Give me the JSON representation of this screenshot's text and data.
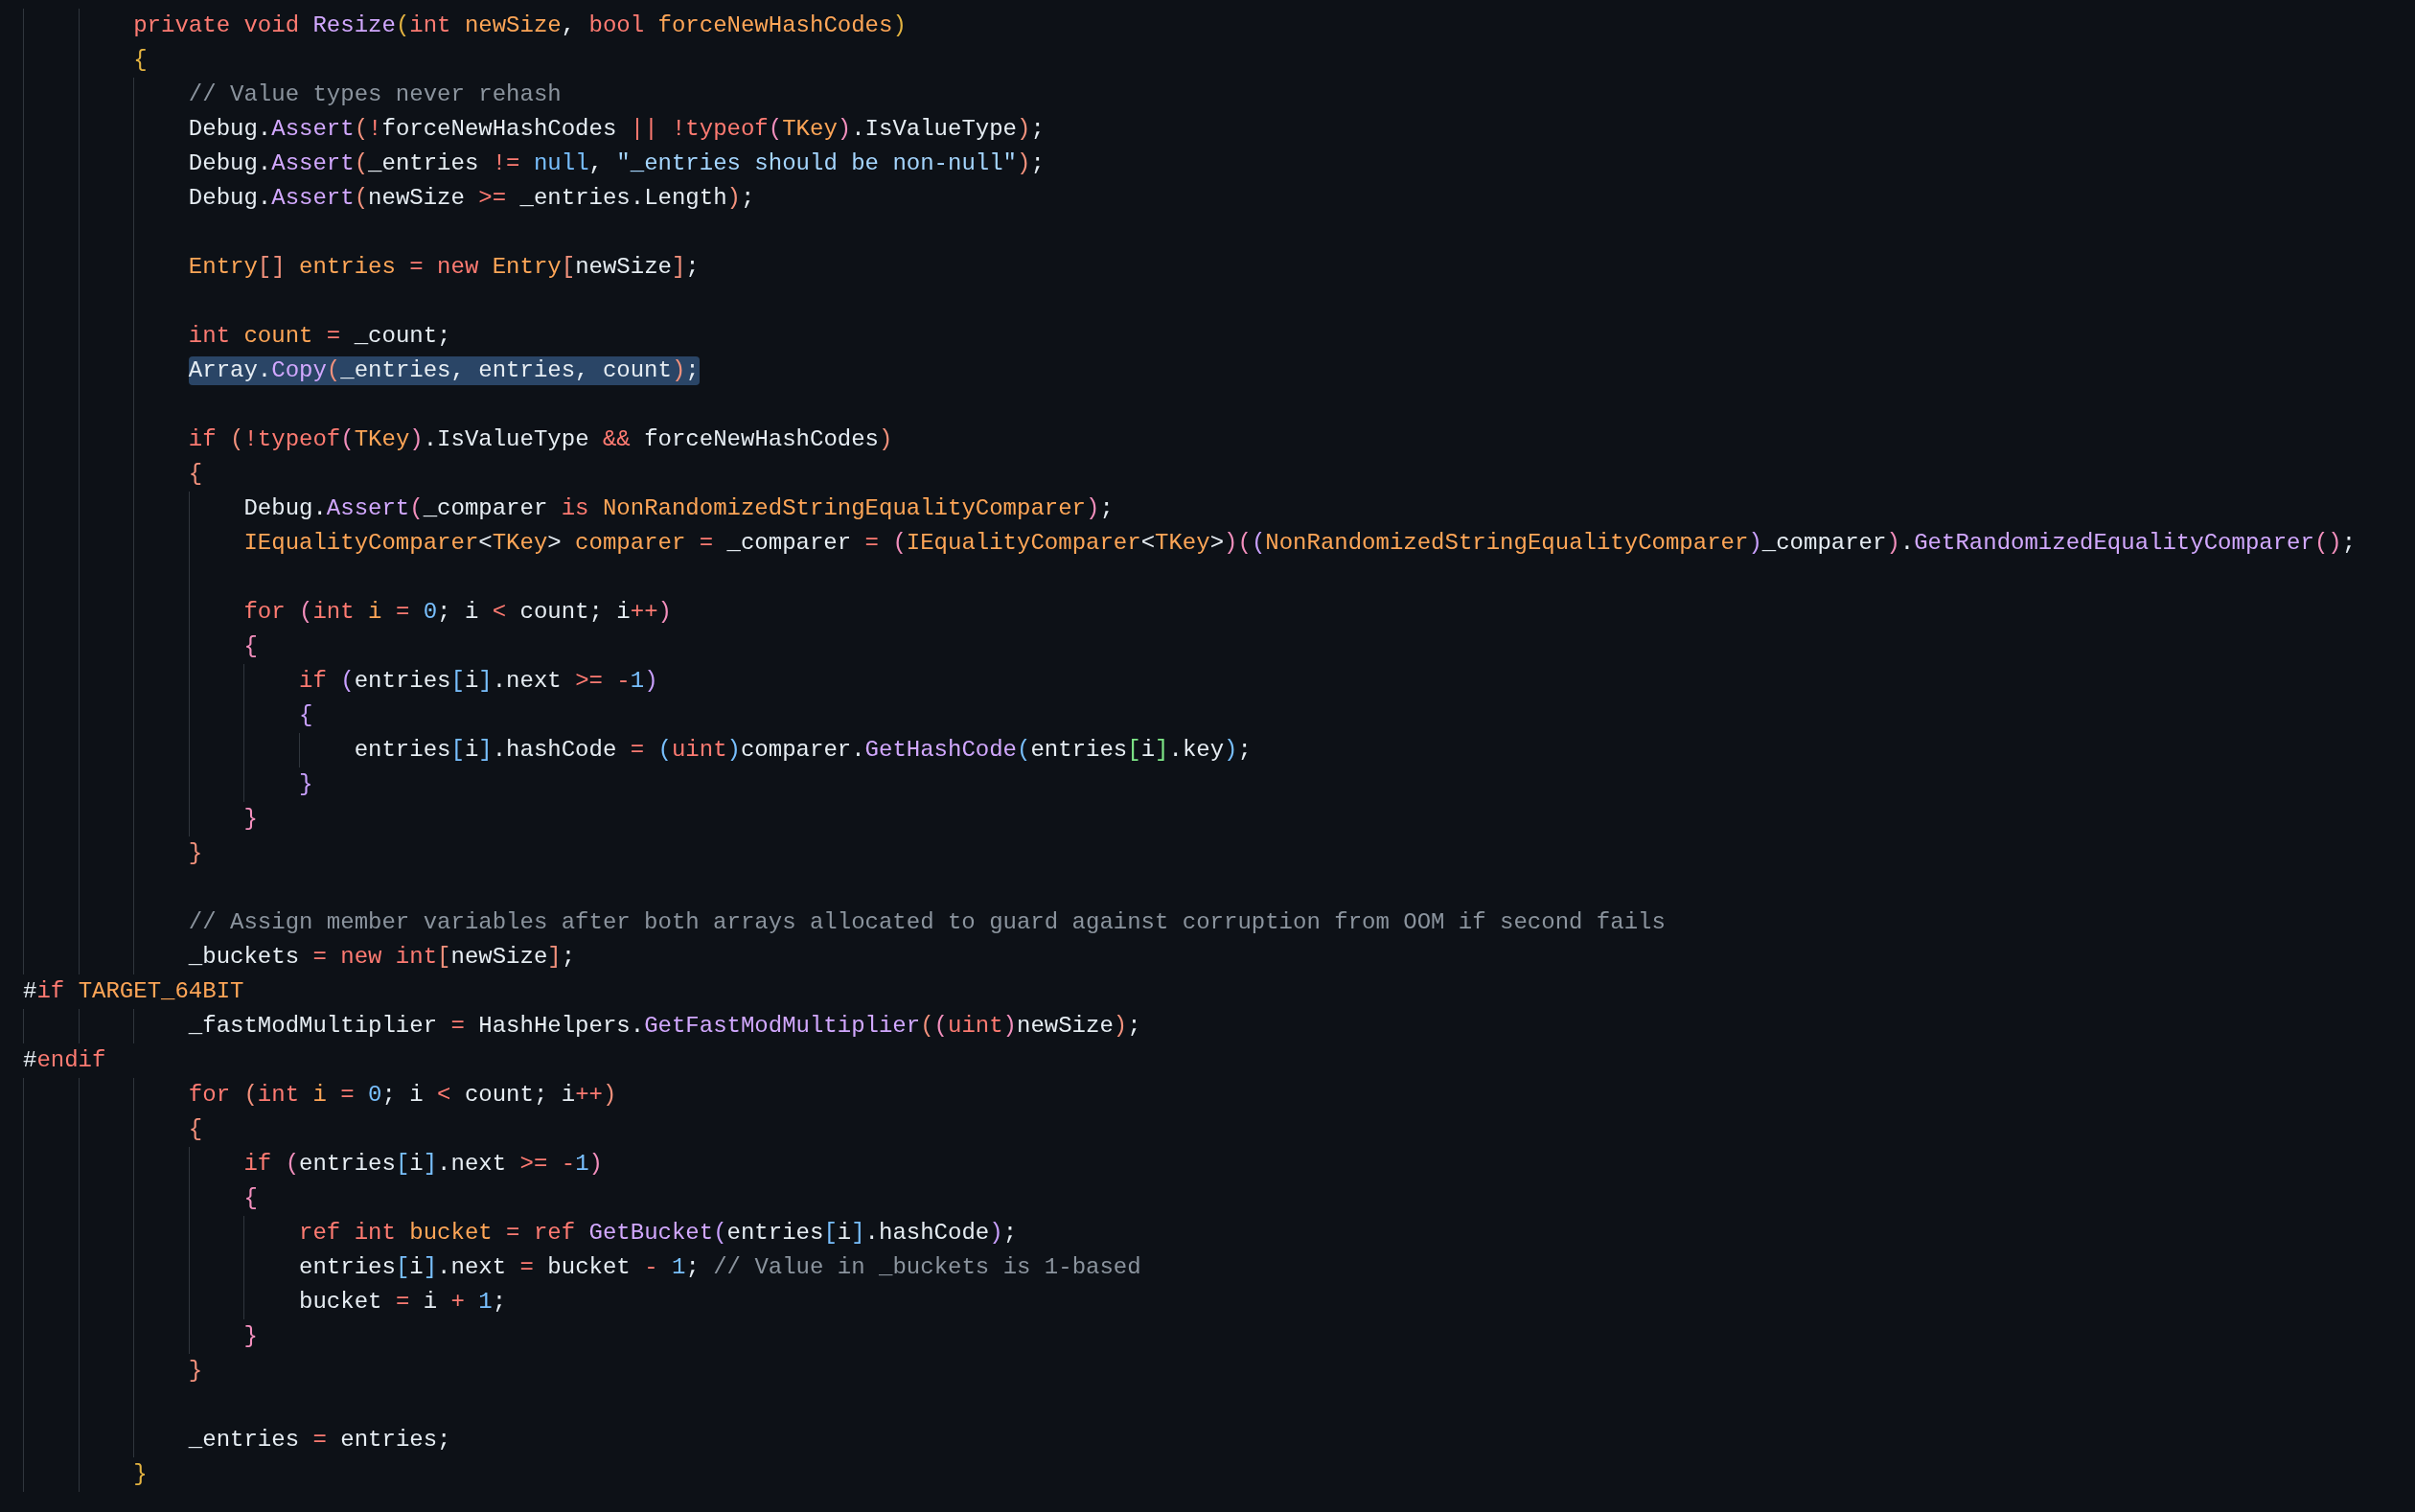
{
  "editor": {
    "lines": [
      {
        "kind": "code",
        "selected": false,
        "tokens": [
          {
            "kind": "keyword",
            "text": "private void "
          },
          {
            "kind": "method",
            "text": "Resize"
          },
          {
            "kind": "brace1",
            "text": "("
          },
          {
            "kind": "keyword",
            "text": "int "
          },
          {
            "kind": "type",
            "text": "newSize"
          },
          {
            "kind": "plain",
            "text": ", "
          },
          {
            "kind": "keyword",
            "text": "bool "
          },
          {
            "kind": "type",
            "text": "forceNewHashCodes"
          },
          {
            "kind": "brace1",
            "text": ")"
          }
        ]
      },
      {
        "kind": "code",
        "selected": false,
        "tokens": [
          {
            "kind": "brace1",
            "text": "{"
          }
        ],
        "children": [
          {
            "kind": "code",
            "selected": false,
            "tokens": [
              {
                "kind": "comment",
                "text": "// Value types never rehash"
              }
            ]
          },
          {
            "kind": "code",
            "selected": false,
            "tokens": [
              {
                "kind": "plain",
                "text": "Debug."
              },
              {
                "kind": "method",
                "text": "Assert"
              },
              {
                "kind": "brace2",
                "text": "("
              },
              {
                "kind": "keyword",
                "text": "!"
              },
              {
                "kind": "plain",
                "text": "forceNewHashCodes "
              },
              {
                "kind": "keyword",
                "text": "|| !typeof"
              },
              {
                "kind": "brace3",
                "text": "("
              },
              {
                "kind": "type",
                "text": "TKey"
              },
              {
                "kind": "brace3",
                "text": ")"
              },
              {
                "kind": "plain",
                "text": ".IsValueType"
              },
              {
                "kind": "brace2",
                "text": ")"
              },
              {
                "kind": "plain",
                "text": ";"
              }
            ]
          },
          {
            "kind": "code",
            "selected": false,
            "tokens": [
              {
                "kind": "plain",
                "text": "Debug."
              },
              {
                "kind": "method",
                "text": "Assert"
              },
              {
                "kind": "brace2",
                "text": "("
              },
              {
                "kind": "plain",
                "text": "_entries "
              },
              {
                "kind": "keyword",
                "text": "!= "
              },
              {
                "kind": "number",
                "text": "null"
              },
              {
                "kind": "plain",
                "text": ", "
              },
              {
                "kind": "string",
                "text": "\"_entries should be non-null\""
              },
              {
                "kind": "brace2",
                "text": ")"
              },
              {
                "kind": "plain",
                "text": ";"
              }
            ]
          },
          {
            "kind": "code",
            "selected": false,
            "tokens": [
              {
                "kind": "plain",
                "text": "Debug."
              },
              {
                "kind": "method",
                "text": "Assert"
              },
              {
                "kind": "brace2",
                "text": "("
              },
              {
                "kind": "plain",
                "text": "newSize "
              },
              {
                "kind": "keyword",
                "text": ">= "
              },
              {
                "kind": "plain",
                "text": "_entries.Length"
              },
              {
                "kind": "brace2",
                "text": ")"
              },
              {
                "kind": "plain",
                "text": ";"
              }
            ]
          },
          {
            "kind": "code",
            "selected": false
          },
          {
            "kind": "code",
            "selected": false,
            "tokens": [
              {
                "kind": "type",
                "text": "Entry"
              },
              {
                "kind": "brace2",
                "text": "[]"
              },
              {
                "kind": "type",
                "text": " entries "
              },
              {
                "kind": "keyword",
                "text": "= new "
              },
              {
                "kind": "type",
                "text": "Entry"
              },
              {
                "kind": "brace2",
                "text": "["
              },
              {
                "kind": "plain",
                "text": "newSize"
              },
              {
                "kind": "brace2",
                "text": "]"
              },
              {
                "kind": "plain",
                "text": ";"
              }
            ]
          },
          {
            "kind": "code",
            "selected": false
          },
          {
            "kind": "code",
            "selected": false,
            "tokens": [
              {
                "kind": "keyword",
                "text": "int "
              },
              {
                "kind": "type",
                "text": "count "
              },
              {
                "kind": "keyword",
                "text": "= "
              },
              {
                "kind": "plain",
                "text": "_count;"
              }
            ]
          },
          {
            "kind": "code",
            "selected": true,
            "tokens": [
              {
                "kind": "plain",
                "text": "Array."
              },
              {
                "kind": "method",
                "text": "Copy"
              },
              {
                "kind": "brace2",
                "text": "("
              },
              {
                "kind": "plain",
                "text": "_entries, entries, count"
              },
              {
                "kind": "brace2",
                "text": ")"
              },
              {
                "kind": "plain",
                "text": ";"
              }
            ]
          },
          {
            "kind": "code",
            "selected": false
          },
          {
            "kind": "code",
            "selected": false,
            "tokens": [
              {
                "kind": "keyword",
                "text": "if "
              },
              {
                "kind": "brace2",
                "text": "("
              },
              {
                "kind": "keyword",
                "text": "!typeof"
              },
              {
                "kind": "brace3",
                "text": "("
              },
              {
                "kind": "type",
                "text": "TKey"
              },
              {
                "kind": "brace3",
                "text": ")"
              },
              {
                "kind": "plain",
                "text": ".IsValueType "
              },
              {
                "kind": "keyword",
                "text": "&& "
              },
              {
                "kind": "plain",
                "text": "forceNewHashCodes"
              },
              {
                "kind": "brace2",
                "text": ")"
              }
            ]
          },
          {
            "kind": "code",
            "selected": false,
            "tokens": [
              {
                "kind": "brace2",
                "text": "{"
              }
            ],
            "children": [
              {
                "kind": "code",
                "selected": false,
                "tokens": [
                  {
                    "kind": "plain",
                    "text": "Debug."
                  },
                  {
                    "kind": "method",
                    "text": "Assert"
                  },
                  {
                    "kind": "brace3",
                    "text": "("
                  },
                  {
                    "kind": "plain",
                    "text": "_comparer "
                  },
                  {
                    "kind": "keyword",
                    "text": "is "
                  },
                  {
                    "kind": "type",
                    "text": "NonRandomizedStringEqualityComparer"
                  },
                  {
                    "kind": "brace3",
                    "text": ")"
                  },
                  {
                    "kind": "plain",
                    "text": ";"
                  }
                ]
              },
              {
                "kind": "code",
                "selected": false,
                "tokens": [
                  {
                    "kind": "type",
                    "text": "IEqualityComparer"
                  },
                  {
                    "kind": "plain",
                    "text": "<"
                  },
                  {
                    "kind": "type",
                    "text": "TKey"
                  },
                  {
                    "kind": "plain",
                    "text": "> "
                  },
                  {
                    "kind": "type",
                    "text": "comparer "
                  },
                  {
                    "kind": "keyword",
                    "text": "= "
                  },
                  {
                    "kind": "plain",
                    "text": "_comparer "
                  },
                  {
                    "kind": "keyword",
                    "text": "= "
                  },
                  {
                    "kind": "brace3",
                    "text": "("
                  },
                  {
                    "kind": "type",
                    "text": "IEqualityComparer"
                  },
                  {
                    "kind": "plain",
                    "text": "<"
                  },
                  {
                    "kind": "type",
                    "text": "TKey"
                  },
                  {
                    "kind": "plain",
                    "text": ">"
                  },
                  {
                    "kind": "brace3",
                    "text": ")("
                  },
                  {
                    "kind": "brace4",
                    "text": "("
                  },
                  {
                    "kind": "type",
                    "text": "NonRandomizedStringEqualityComparer"
                  },
                  {
                    "kind": "brace4",
                    "text": ")"
                  },
                  {
                    "kind": "plain",
                    "text": "_comparer"
                  },
                  {
                    "kind": "brace3",
                    "text": ")"
                  },
                  {
                    "kind": "plain",
                    "text": "."
                  },
                  {
                    "kind": "method",
                    "text": "GetRandomizedEqualityComparer"
                  },
                  {
                    "kind": "brace3",
                    "text": "()"
                  },
                  {
                    "kind": "plain",
                    "text": ";"
                  }
                ]
              },
              {
                "kind": "code",
                "selected": false
              },
              {
                "kind": "code",
                "selected": false,
                "tokens": [
                  {
                    "kind": "keyword",
                    "text": "for "
                  },
                  {
                    "kind": "brace3",
                    "text": "("
                  },
                  {
                    "kind": "keyword",
                    "text": "int "
                  },
                  {
                    "kind": "type",
                    "text": "i "
                  },
                  {
                    "kind": "keyword",
                    "text": "= "
                  },
                  {
                    "kind": "number",
                    "text": "0"
                  },
                  {
                    "kind": "plain",
                    "text": "; i "
                  },
                  {
                    "kind": "keyword",
                    "text": "< "
                  },
                  {
                    "kind": "plain",
                    "text": "count; i"
                  },
                  {
                    "kind": "keyword",
                    "text": "++"
                  },
                  {
                    "kind": "brace3",
                    "text": ")"
                  }
                ]
              },
              {
                "kind": "code",
                "selected": false,
                "tokens": [
                  {
                    "kind": "brace3",
                    "text": "{"
                  }
                ],
                "children": [
                  {
                    "kind": "code",
                    "selected": false,
                    "tokens": [
                      {
                        "kind": "keyword",
                        "text": "if "
                      },
                      {
                        "kind": "brace4",
                        "text": "("
                      },
                      {
                        "kind": "plain",
                        "text": "entries"
                      },
                      {
                        "kind": "brace5",
                        "text": "["
                      },
                      {
                        "kind": "plain",
                        "text": "i"
                      },
                      {
                        "kind": "brace5",
                        "text": "]"
                      },
                      {
                        "kind": "plain",
                        "text": ".next "
                      },
                      {
                        "kind": "keyword",
                        "text": ">= -"
                      },
                      {
                        "kind": "number",
                        "text": "1"
                      },
                      {
                        "kind": "brace4",
                        "text": ")"
                      }
                    ]
                  },
                  {
                    "kind": "code",
                    "selected": false,
                    "tokens": [
                      {
                        "kind": "brace4",
                        "text": "{"
                      }
                    ],
                    "children": [
                      {
                        "kind": "code",
                        "selected": false,
                        "tokens": [
                          {
                            "kind": "plain",
                            "text": "entries"
                          },
                          {
                            "kind": "brace5",
                            "text": "["
                          },
                          {
                            "kind": "plain",
                            "text": "i"
                          },
                          {
                            "kind": "brace5",
                            "text": "]"
                          },
                          {
                            "kind": "plain",
                            "text": ".hashCode "
                          },
                          {
                            "kind": "keyword",
                            "text": "= "
                          },
                          {
                            "kind": "brace5",
                            "text": "("
                          },
                          {
                            "kind": "keyword",
                            "text": "uint"
                          },
                          {
                            "kind": "brace5",
                            "text": ")"
                          },
                          {
                            "kind": "plain",
                            "text": "comparer."
                          },
                          {
                            "kind": "method",
                            "text": "GetHashCode"
                          },
                          {
                            "kind": "brace5",
                            "text": "("
                          },
                          {
                            "kind": "plain",
                            "text": "entries"
                          },
                          {
                            "kind": "brace6",
                            "text": "["
                          },
                          {
                            "kind": "plain",
                            "text": "i"
                          },
                          {
                            "kind": "brace6",
                            "text": "]"
                          },
                          {
                            "kind": "plain",
                            "text": ".key"
                          },
                          {
                            "kind": "brace5",
                            "text": ")"
                          },
                          {
                            "kind": "plain",
                            "text": ";"
                          }
                        ]
                      }
                    ]
                  },
                  {
                    "kind": "code",
                    "selected": false,
                    "tokens": [
                      {
                        "kind": "brace4",
                        "text": "}"
                      }
                    ]
                  }
                ]
              },
              {
                "kind": "code",
                "selected": false,
                "tokens": [
                  {
                    "kind": "brace3",
                    "text": "}"
                  }
                ]
              }
            ]
          },
          {
            "kind": "code",
            "selected": false,
            "tokens": [
              {
                "kind": "brace2",
                "text": "}"
              }
            ]
          },
          {
            "kind": "code",
            "selected": false
          },
          {
            "kind": "code",
            "selected": false,
            "tokens": [
              {
                "kind": "comment",
                "text": "// Assign member variables after both arrays allocated to guard against corruption from OOM if second fails"
              }
            ]
          },
          {
            "kind": "code",
            "selected": false,
            "tokens": [
              {
                "kind": "plain",
                "text": "_buckets "
              },
              {
                "kind": "keyword",
                "text": "= new int"
              },
              {
                "kind": "brace2",
                "text": "["
              },
              {
                "kind": "plain",
                "text": "newSize"
              },
              {
                "kind": "brace2",
                "text": "]"
              },
              {
                "kind": "plain",
                "text": ";"
              }
            ]
          },
          {
            "kind": "directive",
            "selected": false,
            "tokens": [
              {
                "kind": "plain",
                "text": "#"
              },
              {
                "kind": "keyword",
                "text": "if "
              },
              {
                "kind": "type",
                "text": "TARGET_64BIT"
              }
            ]
          },
          {
            "kind": "code",
            "selected": false,
            "tokens": [
              {
                "kind": "plain",
                "text": "_fastModMultiplier "
              },
              {
                "kind": "keyword",
                "text": "= "
              },
              {
                "kind": "plain",
                "text": "HashHelpers."
              },
              {
                "kind": "method",
                "text": "GetFastModMultiplier"
              },
              {
                "kind": "brace2",
                "text": "("
              },
              {
                "kind": "brace3",
                "text": "("
              },
              {
                "kind": "keyword",
                "text": "uint"
              },
              {
                "kind": "brace3",
                "text": ")"
              },
              {
                "kind": "plain",
                "text": "newSize"
              },
              {
                "kind": "brace2",
                "text": ")"
              },
              {
                "kind": "plain",
                "text": ";"
              }
            ]
          },
          {
            "kind": "directive",
            "selected": false,
            "tokens": [
              {
                "kind": "plain",
                "text": "#"
              },
              {
                "kind": "keyword",
                "text": "endif"
              }
            ]
          },
          {
            "kind": "code",
            "selected": false,
            "tokens": [
              {
                "kind": "keyword",
                "text": "for "
              },
              {
                "kind": "brace2",
                "text": "("
              },
              {
                "kind": "keyword",
                "text": "int "
              },
              {
                "kind": "type",
                "text": "i "
              },
              {
                "kind": "keyword",
                "text": "= "
              },
              {
                "kind": "number",
                "text": "0"
              },
              {
                "kind": "plain",
                "text": "; i "
              },
              {
                "kind": "keyword",
                "text": "< "
              },
              {
                "kind": "plain",
                "text": "count; i"
              },
              {
                "kind": "keyword",
                "text": "++"
              },
              {
                "kind": "brace2",
                "text": ")"
              }
            ]
          },
          {
            "kind": "code",
            "selected": false,
            "tokens": [
              {
                "kind": "brace2",
                "text": "{"
              }
            ],
            "children": [
              {
                "kind": "code",
                "selected": false,
                "tokens": [
                  {
                    "kind": "keyword",
                    "text": "if "
                  },
                  {
                    "kind": "brace3",
                    "text": "("
                  },
                  {
                    "kind": "plain",
                    "text": "entries"
                  },
                  {
                    "kind": "brace5",
                    "text": "["
                  },
                  {
                    "kind": "plain",
                    "text": "i"
                  },
                  {
                    "kind": "brace5",
                    "text": "]"
                  },
                  {
                    "kind": "plain",
                    "text": ".next "
                  },
                  {
                    "kind": "keyword",
                    "text": ">= -"
                  },
                  {
                    "kind": "number",
                    "text": "1"
                  },
                  {
                    "kind": "brace3",
                    "text": ")"
                  }
                ]
              },
              {
                "kind": "code",
                "selected": false,
                "tokens": [
                  {
                    "kind": "brace3",
                    "text": "{"
                  }
                ],
                "children": [
                  {
                    "kind": "code",
                    "selected": false,
                    "tokens": [
                      {
                        "kind": "keyword",
                        "text": "ref int "
                      },
                      {
                        "kind": "type",
                        "text": "bucket "
                      },
                      {
                        "kind": "keyword",
                        "text": "= ref "
                      },
                      {
                        "kind": "method",
                        "text": "GetBucket"
                      },
                      {
                        "kind": "brace4",
                        "text": "("
                      },
                      {
                        "kind": "plain",
                        "text": "entries"
                      },
                      {
                        "kind": "brace5",
                        "text": "["
                      },
                      {
                        "kind": "plain",
                        "text": "i"
                      },
                      {
                        "kind": "brace5",
                        "text": "]"
                      },
                      {
                        "kind": "plain",
                        "text": ".hashCode"
                      },
                      {
                        "kind": "brace4",
                        "text": ")"
                      },
                      {
                        "kind": "plain",
                        "text": ";"
                      }
                    ]
                  },
                  {
                    "kind": "code",
                    "selected": false,
                    "tokens": [
                      {
                        "kind": "plain",
                        "text": "entries"
                      },
                      {
                        "kind": "brace5",
                        "text": "["
                      },
                      {
                        "kind": "plain",
                        "text": "i"
                      },
                      {
                        "kind": "brace5",
                        "text": "]"
                      },
                      {
                        "kind": "plain",
                        "text": ".next "
                      },
                      {
                        "kind": "keyword",
                        "text": "= "
                      },
                      {
                        "kind": "plain",
                        "text": "bucket "
                      },
                      {
                        "kind": "keyword",
                        "text": "- "
                      },
                      {
                        "kind": "number",
                        "text": "1"
                      },
                      {
                        "kind": "plain",
                        "text": "; "
                      },
                      {
                        "kind": "comment",
                        "text": "// Value in _buckets is 1-based"
                      }
                    ]
                  },
                  {
                    "kind": "code",
                    "selected": false,
                    "tokens": [
                      {
                        "kind": "plain",
                        "text": "bucket "
                      },
                      {
                        "kind": "keyword",
                        "text": "= "
                      },
                      {
                        "kind": "plain",
                        "text": "i "
                      },
                      {
                        "kind": "keyword",
                        "text": "+ "
                      },
                      {
                        "kind": "number",
                        "text": "1"
                      },
                      {
                        "kind": "plain",
                        "text": ";"
                      }
                    ]
                  }
                ]
              },
              {
                "kind": "code",
                "selected": false,
                "tokens": [
                  {
                    "kind": "brace3",
                    "text": "}"
                  }
                ]
              }
            ]
          },
          {
            "kind": "code",
            "selected": false,
            "tokens": [
              {
                "kind": "brace2",
                "text": "}"
              }
            ]
          },
          {
            "kind": "code",
            "selected": false
          },
          {
            "kind": "code",
            "selected": false,
            "tokens": [
              {
                "kind": "plain",
                "text": "_entries "
              },
              {
                "kind": "keyword",
                "text": "= "
              },
              {
                "kind": "plain",
                "text": "entries;"
              }
            ]
          }
        ]
      },
      {
        "kind": "code",
        "selected": false,
        "tokens": [
          {
            "kind": "brace1",
            "text": "}"
          }
        ]
      }
    ]
  }
}
